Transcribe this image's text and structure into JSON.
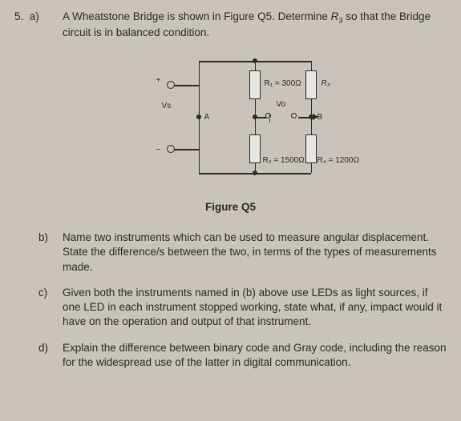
{
  "q": {
    "num": "5.",
    "a_label": "a)",
    "a_text1": "A Wheatstone Bridge is shown in Figure Q5. Determine ",
    "a_r3": "R",
    "a_r3sub": "3",
    "a_text2": " so that the Bridge circuit is in balanced condition.",
    "b_label": "b)",
    "b_text": "Name two instruments which can be used to measure angular displacement. State the difference/s between the two, in terms of the types of measurements made.",
    "c_label": "c)",
    "c_text": "Given both the instruments named in (b) above use LEDs as light sources, if one LED in each instrument stopped working, state what, if any, impact would it have on the operation and output of that instrument.",
    "d_label": "d)",
    "d_text": "Explain the difference between binary code and Gray code, including the reason for the widespread use of the latter in digital communication."
  },
  "fig": {
    "caption": "Figure Q5",
    "plus": "+",
    "minus": "−",
    "vs": "Vs",
    "A": "A",
    "B": "B",
    "Vo": "Vo",
    "R1": "R₁ = 300Ω",
    "R2": "R₂ = 1500Ω",
    "R3": "R₃",
    "R4": "R₄ = 1200Ω",
    "circuit_values": {
      "R1": 300,
      "R2": 1500,
      "R4": 1200,
      "R3_unknown": true,
      "units": "Ω"
    }
  }
}
